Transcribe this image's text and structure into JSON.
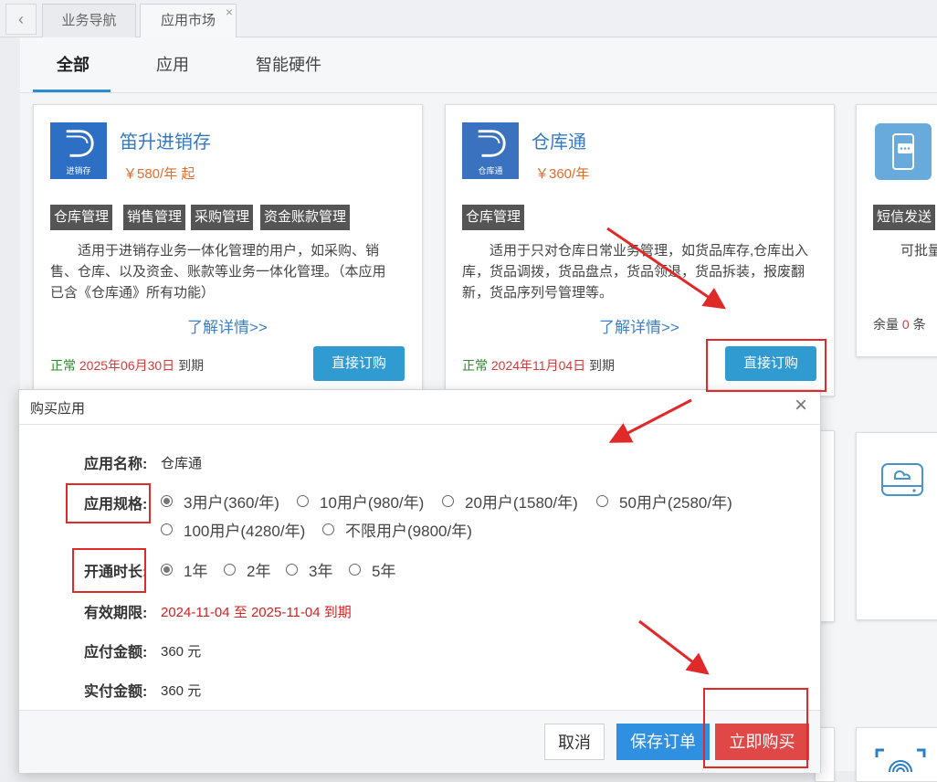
{
  "nav": {
    "back_icon": "‹",
    "tabs": [
      {
        "label": "业务导航"
      },
      {
        "label": "应用市场",
        "close": "×"
      }
    ]
  },
  "categories": [
    {
      "label": "全部"
    },
    {
      "label": "应用"
    },
    {
      "label": "智能硬件"
    }
  ],
  "cards": [
    {
      "name": "笛升进销存",
      "logo_text": "进销存",
      "price": "￥580/年 起",
      "tags": [
        "仓库管理",
        "销售管理",
        "采购管理",
        "资金账款管理"
      ],
      "desc": "适用于进销存业务一体化管理的用户，如采购、销售、仓库、以及资金、账款等业务一体化管理。（本应用已含《仓库通》所有功能）",
      "more": "了解详情>>",
      "status": "正常",
      "expire": "2025年06月30日",
      "expire_suffix": "到期",
      "button": "直接订购"
    },
    {
      "name": "仓库通",
      "logo_text": "仓库通",
      "price": "￥360/年",
      "tags": [
        "仓库管理"
      ],
      "desc": "适用于只对仓库日常业务管理，如货品库存,仓库出入库，货品调拨，货品盘点，货品领退，货品拆装，报废翻新，货品序列号管理等。",
      "more": "了解详情>>",
      "status": "正常",
      "expire": "2024年11月04日",
      "expire_suffix": "到期",
      "button": "直接订购"
    },
    {
      "tag": "短信发送",
      "desc": "可批量发",
      "remain_label": "余量",
      "remain_value": "0",
      "remain_unit": "条"
    }
  ],
  "modal": {
    "title": "购买应用",
    "close": "×",
    "app_name_label": "应用名称:",
    "app_name_value": "仓库通",
    "spec_label": "应用规格:",
    "spec_options": [
      "3用户(360/年)",
      "10用户(980/年)",
      "20用户(1580/年)",
      "50用户(2580/年)",
      "100用户(4280/年)",
      "不限用户(9800/年)"
    ],
    "spec_selected": "3用户(360/年)",
    "duration_label": "开通时长:",
    "duration_options": [
      "1年",
      "2年",
      "3年",
      "5年"
    ],
    "duration_selected": "1年",
    "validity_label": "有效期限:",
    "validity_value": "2024-11-04 至 2025-11-04 到期",
    "payable_label": "应付金额:",
    "payable_value": "360 元",
    "actual_label": "实付金额:",
    "actual_value": "360 元",
    "buttons": {
      "cancel": "取消",
      "save": "保存订单",
      "buy": "立即购买"
    }
  },
  "colors": {
    "accent": "#2f9bd0",
    "danger": "#e04848",
    "price": "#e36c2a"
  }
}
